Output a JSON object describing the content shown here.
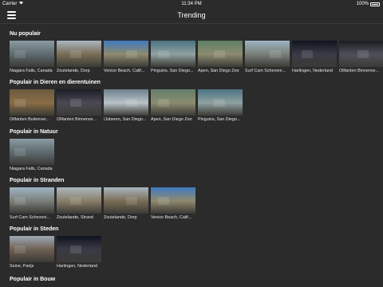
{
  "status_bar": {
    "carrier": "Carrier",
    "time": "11:34 PM",
    "battery": "100%"
  },
  "nav": {
    "title": "Trending"
  },
  "sections": [
    {
      "title": "Nu populair",
      "items": [
        {
          "caption": "Niagara Falls, Canada",
          "palette": [
            "#8c9ba3",
            "#5d6a6e"
          ]
        },
        {
          "caption": "Zoutelande, Dorp",
          "palette": [
            "#a9b6bf",
            "#7a6d55"
          ]
        },
        {
          "caption": "Venice Beach, Calif...",
          "palette": [
            "#3f79c2",
            "#8f8a6d"
          ]
        },
        {
          "caption": "Pinguins, San Diego...",
          "palette": [
            "#4a7382",
            "#8fa1a0"
          ]
        },
        {
          "caption": "Apen, San Diego Zoo",
          "palette": [
            "#5e7f63",
            "#8d8b70"
          ]
        },
        {
          "caption": "Surf Cam Scheveni...",
          "palette": [
            "#9fb4c4",
            "#7a7f78"
          ]
        },
        {
          "caption": "Harlingen, Nederland",
          "palette": [
            "#10131e",
            "#3a3b46"
          ]
        },
        {
          "caption": "Olifanten Binnenve...",
          "palette": [
            "#1b1d22",
            "#50505a"
          ]
        }
      ]
    },
    {
      "title": "Populair in Dieren en dierentuinen",
      "items": [
        {
          "caption": "Olifanten Buitenver...",
          "palette": [
            "#6a5a3e",
            "#8b6d46"
          ]
        },
        {
          "caption": "Olifanten Binnenve...",
          "palette": [
            "#1c1e26",
            "#4b4a55"
          ]
        },
        {
          "caption": "IJsberen, San Diego...",
          "palette": [
            "#6b7f8c",
            "#b9c3c8"
          ]
        },
        {
          "caption": "Apen, San Diego Zoo",
          "palette": [
            "#62806a",
            "#8c8b6f"
          ]
        },
        {
          "caption": "Pinguins, San Diego...",
          "palette": [
            "#4a7382",
            "#8fa1a0"
          ]
        }
      ]
    },
    {
      "title": "Populair in Natuur",
      "items": [
        {
          "caption": "Niagara Falls, Canada",
          "palette": [
            "#8c9ba3",
            "#5d6a6e"
          ]
        }
      ]
    },
    {
      "title": "Populair in Stranden",
      "items": [
        {
          "caption": "Surf Cam Scheveni...",
          "palette": [
            "#9fb4c4",
            "#7a7f78"
          ]
        },
        {
          "caption": "Zoutelande, Strand",
          "palette": [
            "#aab7c0",
            "#8a7f68"
          ]
        },
        {
          "caption": "Zoutelande, Dorp",
          "palette": [
            "#a9b6bf",
            "#7a6d55"
          ]
        },
        {
          "caption": "Venice Beach, Calif...",
          "palette": [
            "#3f79c2",
            "#8f8a6d"
          ]
        }
      ]
    },
    {
      "title": "Populair in Steden",
      "items": [
        {
          "caption": "Seine, Parijs",
          "palette": [
            "#9ea9b5",
            "#6d5f52"
          ]
        },
        {
          "caption": "Harlingen, Nederland",
          "palette": [
            "#10131e",
            "#3a3b46"
          ]
        }
      ]
    },
    {
      "title": "Populair in Bouw",
      "items": []
    }
  ]
}
